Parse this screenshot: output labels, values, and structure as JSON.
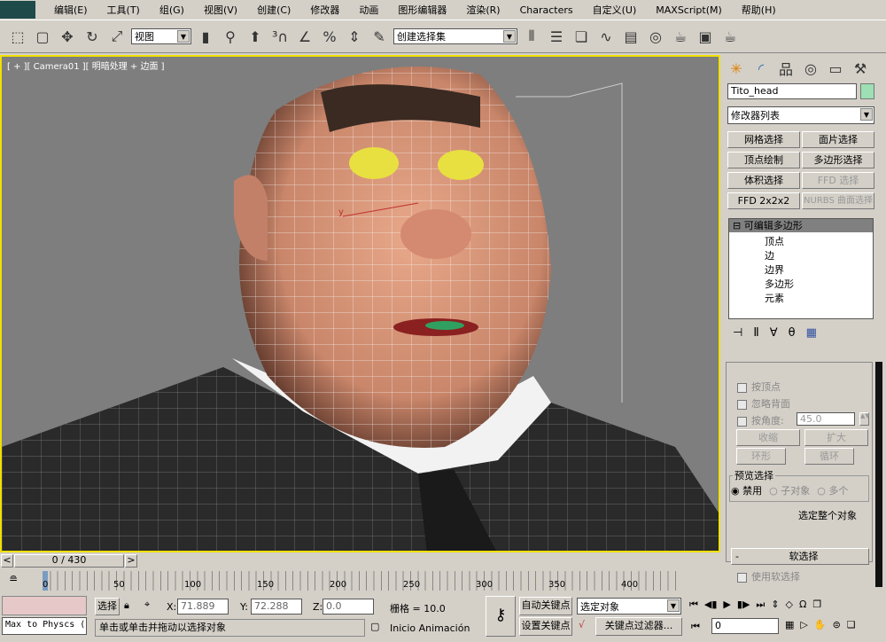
{
  "menu": [
    "编辑(E)",
    "工具(T)",
    "组(G)",
    "视图(V)",
    "创建(C)",
    "修改器",
    "动画",
    "图形编辑器",
    "渲染(R)",
    "Characters",
    "自定义(U)",
    "MAXScript(M)",
    "帮助(H)"
  ],
  "toolbar": {
    "ref_coord": "视图",
    "named_selection": "创建选择集"
  },
  "viewport": {
    "label": "[ + ][ Camera01 ][ 明暗处理 + 边面 ]",
    "bg": "#7e7e7e",
    "border": "#f0e000"
  },
  "panel": {
    "object_name": "Tito_head",
    "object_color": "#9de0b4",
    "modifier_list": "修改器列表",
    "mod_buttons": [
      {
        "label": "网格选择",
        "enabled": true
      },
      {
        "label": "面片选择",
        "enabled": true
      },
      {
        "label": "顶点绘制",
        "enabled": true
      },
      {
        "label": "多边形选择",
        "enabled": true
      },
      {
        "label": "体积选择",
        "enabled": true
      },
      {
        "label": "FFD 选择",
        "enabled": false
      },
      {
        "label": "FFD 2x2x2",
        "enabled": true
      },
      {
        "label": "NURBS 曲面选择",
        "enabled": false
      }
    ],
    "stack_title": "可编辑多边形",
    "stack_items": [
      "顶点",
      "边",
      "边界",
      "多边形",
      "元素"
    ],
    "by_vertex": "按顶点",
    "ignore_back": "忽略背面",
    "by_angle": "按角度:",
    "angle_value": "45.0",
    "shrink": "收缩",
    "grow": "扩大",
    "ring": "环形",
    "loop": "循环",
    "preview_title": "预览选择",
    "preview_options": [
      "禁用",
      "子对象",
      "多个"
    ],
    "preview_selected": "禁用",
    "select_whole": "选定整个对象",
    "soft_title": "软选择",
    "use_soft": "使用软选择"
  },
  "timeline": {
    "frame": "0 / 430",
    "ticks": [
      "0",
      "50",
      "100",
      "150",
      "200",
      "250",
      "300",
      "350",
      "400"
    ]
  },
  "status": {
    "maxscript": "Max to Physcs (",
    "select_label": "选择",
    "x_label": "X:",
    "x": "71.889",
    "y_label": "Y:",
    "y": "72.288",
    "z_label": "Z:",
    "z": "0.0",
    "grid": "栅格 = 10.0",
    "prompt": "单击或单击并拖动以选择对象",
    "inicio": "Inicio Animación",
    "auto_key": "自动关键点",
    "set_key": "设置关键点",
    "key_mode": "选定对象",
    "key_filters": "关键点过滤器...",
    "current_frame": "0"
  }
}
